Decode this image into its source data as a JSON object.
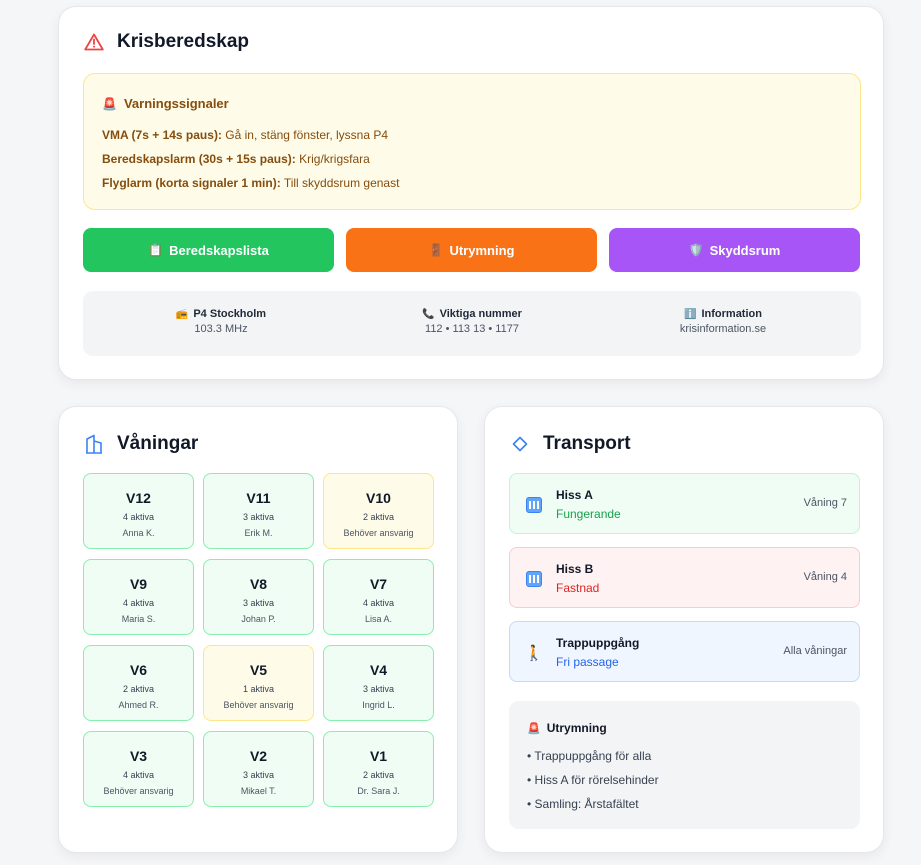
{
  "colors": {
    "green": "#22c55e",
    "orange": "#f97316",
    "purple": "#a855f7",
    "warning_bg": "#fefbe8",
    "warning_text": "#854d0e"
  },
  "crisis": {
    "title": "Krisberedskap",
    "icon": "warning-triangle-icon",
    "warnings": {
      "heading": "Varningssignaler",
      "heading_emoji": "🚨",
      "lines": [
        {
          "label": "VMA (7s + 14s paus):",
          "text": " Gå in, stäng fönster, lyssna P4"
        },
        {
          "label": "Beredskapslarm (30s + 15s paus):",
          "text": " Krig/krigsfara"
        },
        {
          "label": "Flyglarm (korta signaler 1 min):",
          "text": " Till skyddsrum genast"
        }
      ]
    },
    "buttons": [
      {
        "emoji": "📋",
        "label": "Beredskapslista"
      },
      {
        "emoji": "🚪",
        "label": "Utrymning"
      },
      {
        "emoji": "🛡️",
        "label": "Skyddsrum"
      }
    ],
    "info": [
      {
        "emoji": "📻",
        "title": "P4 Stockholm",
        "value": "103.3 MHz"
      },
      {
        "emoji": "📞",
        "title": "Viktiga nummer",
        "value": "112 • 113 13 • 1177"
      },
      {
        "emoji": "ℹ️",
        "title": "Information",
        "value": "krisinformation.se"
      }
    ]
  },
  "floors": {
    "title": "Våningar",
    "icon": "building-icon",
    "items": [
      {
        "name": "V12",
        "active": "4 aktiva",
        "person": "Anna K.",
        "status": "ok"
      },
      {
        "name": "V11",
        "active": "3 aktiva",
        "person": "Erik M.",
        "status": "ok"
      },
      {
        "name": "V10",
        "active": "2 aktiva",
        "person": "Behöver ansvarig",
        "status": "warn"
      },
      {
        "name": "V9",
        "active": "4 aktiva",
        "person": "Maria S.",
        "status": "ok"
      },
      {
        "name": "V8",
        "active": "3 aktiva",
        "person": "Johan P.",
        "status": "ok"
      },
      {
        "name": "V7",
        "active": "4 aktiva",
        "person": "Lisa A.",
        "status": "ok"
      },
      {
        "name": "V6",
        "active": "2 aktiva",
        "person": "Ahmed R.",
        "status": "ok"
      },
      {
        "name": "V5",
        "active": "1 aktiva",
        "person": "Behöver ansvarig",
        "status": "warn"
      },
      {
        "name": "V4",
        "active": "3 aktiva",
        "person": "Ingrid L.",
        "status": "ok"
      },
      {
        "name": "V3",
        "active": "4 aktiva",
        "person": "Behöver ansvarig",
        "status": "ok"
      },
      {
        "name": "V2",
        "active": "3 aktiva",
        "person": "Mikael T.",
        "status": "ok"
      },
      {
        "name": "V1",
        "active": "2 aktiva",
        "person": "Dr. Sara J.",
        "status": "ok"
      }
    ]
  },
  "transport": {
    "title": "Transport",
    "icon": "diamond-icon",
    "items": [
      {
        "name": "Hiss A",
        "status": "Fungerande",
        "location": "Våning 7",
        "icon": "elevator-icon"
      },
      {
        "name": "Hiss B",
        "status": "Fastnad",
        "location": "Våning 4",
        "icon": "elevator-icon"
      },
      {
        "name": "Trappuppgång",
        "status": "Fri passage",
        "location": "Alla våningar",
        "icon": "walking-person-icon",
        "emoji": "🚶"
      }
    ],
    "evacuation": {
      "heading": "Utrymning",
      "heading_emoji": "🚨",
      "items": [
        "• Trappuppgång för alla",
        "• Hiss A för rörelsehinder",
        "• Samling: Årstafältet"
      ]
    }
  }
}
